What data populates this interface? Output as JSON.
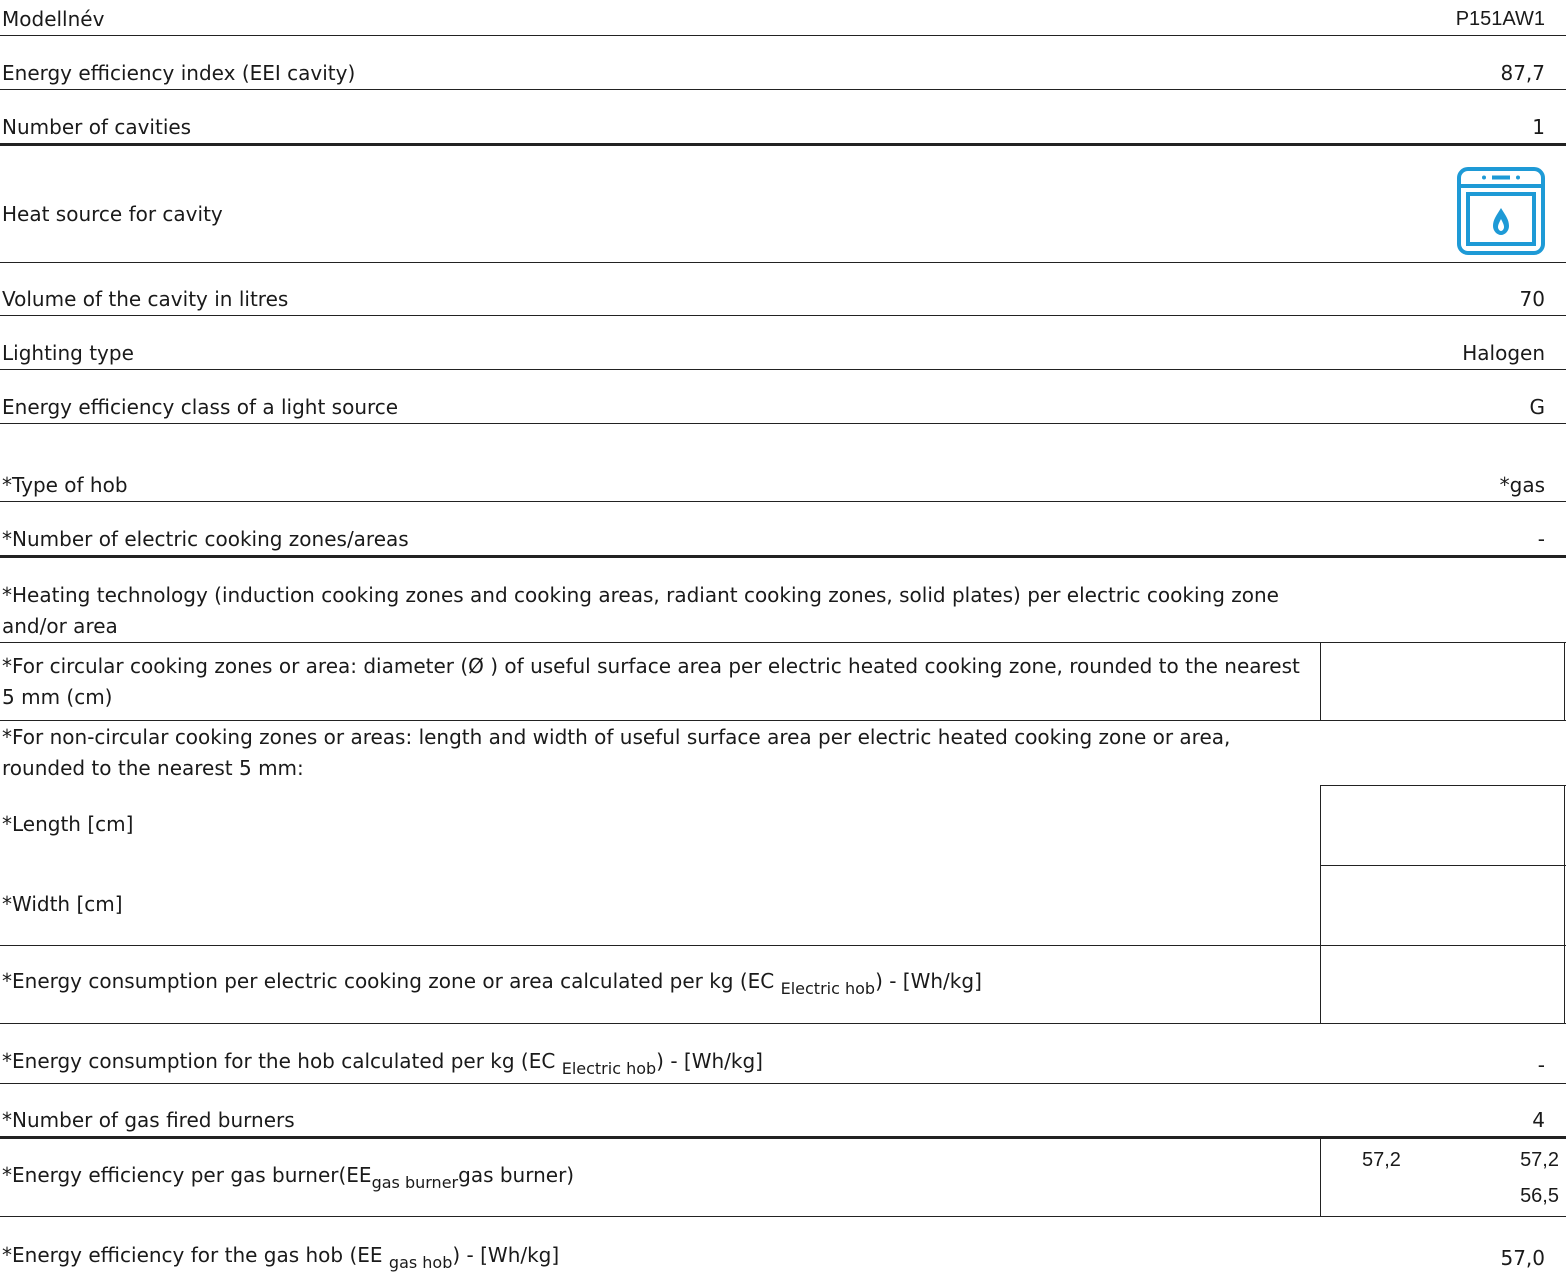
{
  "rows": {
    "model": {
      "label": "Modellnév",
      "value": "P151AW1"
    },
    "eei": {
      "label": "Energy efficiency index (EEI cavity)",
      "value": "87,7"
    },
    "cavities": {
      "label": "Number of cavities",
      "value": "1"
    },
    "heat_source": {
      "label": "Heat source for cavity",
      "icon": "gas-oven-icon",
      "icon_color": "#1e9ad6"
    },
    "volume": {
      "label": "Volume of the cavity in litres",
      "value": "70"
    },
    "lighting": {
      "label": "Lighting type",
      "value": "Halogen"
    },
    "light_class": {
      "label": "Energy efficiency class of a light source",
      "value": "G"
    },
    "hob_type": {
      "label": "*Type of hob",
      "value": "*gas"
    },
    "electric_zones": {
      "label": "*Number of electric cooking zones/areas",
      "value": "-"
    },
    "heating_tech": {
      "label": "*Heating technology (induction cooking zones and cooking areas, radiant cooking zones, solid plates) per electric cooking zone and/or area"
    },
    "circular": {
      "label": "*For circular cooking zones or area: diameter (Ø ) of useful surface area per electric heated cooking zone, rounded to the nearest 5 mm (cm)"
    },
    "noncircular": {
      "label": "*For non-circular cooking zones or areas: length and width of useful surface area per electric heated cooking zone or area, rounded to the nearest 5 mm:"
    },
    "length": {
      "label": "*Length [cm]"
    },
    "width": {
      "label": "*Width [cm]"
    },
    "ec_zone": {
      "label_prefix": "*Energy consumption per electric cooking zone or area calculated per kg (EC ",
      "label_sub": "Electric hob",
      "label_suffix": ") - [Wh/kg]"
    },
    "ec_hob": {
      "label_prefix": "*Energy consumption for the hob calculated per kg (EC ",
      "label_sub": "Electric hob",
      "label_suffix": ") - [Wh/kg]",
      "value": "-"
    },
    "gas_burners": {
      "label": "*Number of gas fired burners",
      "value": "4"
    },
    "ee_burner": {
      "label_prefix": "*Energy efficiency per gas burner(EE",
      "label_sub": "gas burner",
      "label_suffix": "gas burner)",
      "values": [
        "57,2",
        "57,2",
        "56,5"
      ]
    },
    "ee_gas_hob": {
      "label_prefix": "*Energy efficiency for the gas hob (EE ",
      "label_sub": "gas hob",
      "label_suffix": ") - [Wh/kg]",
      "value": "57,0"
    }
  }
}
